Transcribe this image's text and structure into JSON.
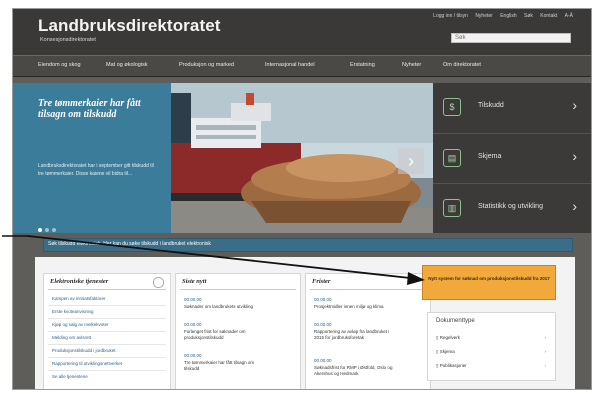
{
  "header": {
    "title": "Landbruksdirektoratet",
    "subtitle": "Konsesjonsdirektoratet",
    "toplinks": [
      "Logg inn / tilsyn",
      "Nyheter",
      "English",
      "Søk",
      "Kontakt",
      "A-Å"
    ],
    "search_placeholder": "Søk"
  },
  "nav": {
    "items": [
      "Eiendom og skog",
      "Mat og økologisk",
      "Produksjon og marked",
      "Internasjonal handel",
      "Erstatning",
      "Nyheter",
      "Om direktoratet"
    ]
  },
  "hero": {
    "title": "Tre tømmerkaier har fått tilsagn om tilskudd",
    "body": "Landbruksdirektoratet har i september gitt tilskudd til tre tømmerkaier. Disse kaiene vil bidra til...",
    "dots": 3
  },
  "side_panel": {
    "items": [
      {
        "label": "Tilskudd",
        "icon": "coin-icon"
      },
      {
        "label": "Skjema",
        "icon": "form-icon"
      },
      {
        "label": "Statistikk og utvikling",
        "icon": "chart-icon"
      }
    ]
  },
  "banner": {
    "text": "Søk tilskudd elektronisk. Her kan du søke tilskudd i landbruket elektronisk"
  },
  "columns": {
    "services": {
      "title": "Elektroniske tjenester",
      "links": [
        "Kampen av innsatsfaktorer",
        "Erste kvoteanvisning",
        "Kjøp og salg av melkekvoter",
        "Melding om avlsrett",
        "Produksjonstilskudd i jordbruket",
        "Rapportering til utviklingsnettverket",
        "Se alle tjenestene"
      ]
    },
    "news": {
      "title": "Siste nytt",
      "items": [
        {
          "date": "00.00.00",
          "text": "Søknader om landbrukets utvikling"
        },
        {
          "date": "00.00.00",
          "text": "Forlenget frist for søknader om produksjonstilskudd"
        },
        {
          "date": "00.00.00",
          "text": "Tre tømmerkaier har fått tilsagn om tilskudd"
        }
      ]
    },
    "events": {
      "title": "Frister",
      "items": [
        {
          "date": "00.00.00",
          "text": "Prosjektmidler innen miljø og klima"
        },
        {
          "date": "00.00.00",
          "text": "Rapportering av avløp fra landbruket i 2015 for jordbruksforetak"
        },
        {
          "date": "00.00.00",
          "text": "Søknadsfrist for RMP i Østfold, Oslo og Akershus og Hedmark"
        }
      ]
    }
  },
  "orange_box": {
    "text": "Nytt system for søknad om produksjonstilskudd fra 2017"
  },
  "doc_box": {
    "title": "Dokumenttype",
    "rows": [
      "Regelverk",
      "Skjema",
      "Publikasjoner"
    ]
  },
  "colors": {
    "header_bg": "#3a3937",
    "hero_blue": "#3a7c99",
    "banner_blue": "#3a6e88",
    "orange": "#f2a93b",
    "link": "#2e5f8a"
  }
}
